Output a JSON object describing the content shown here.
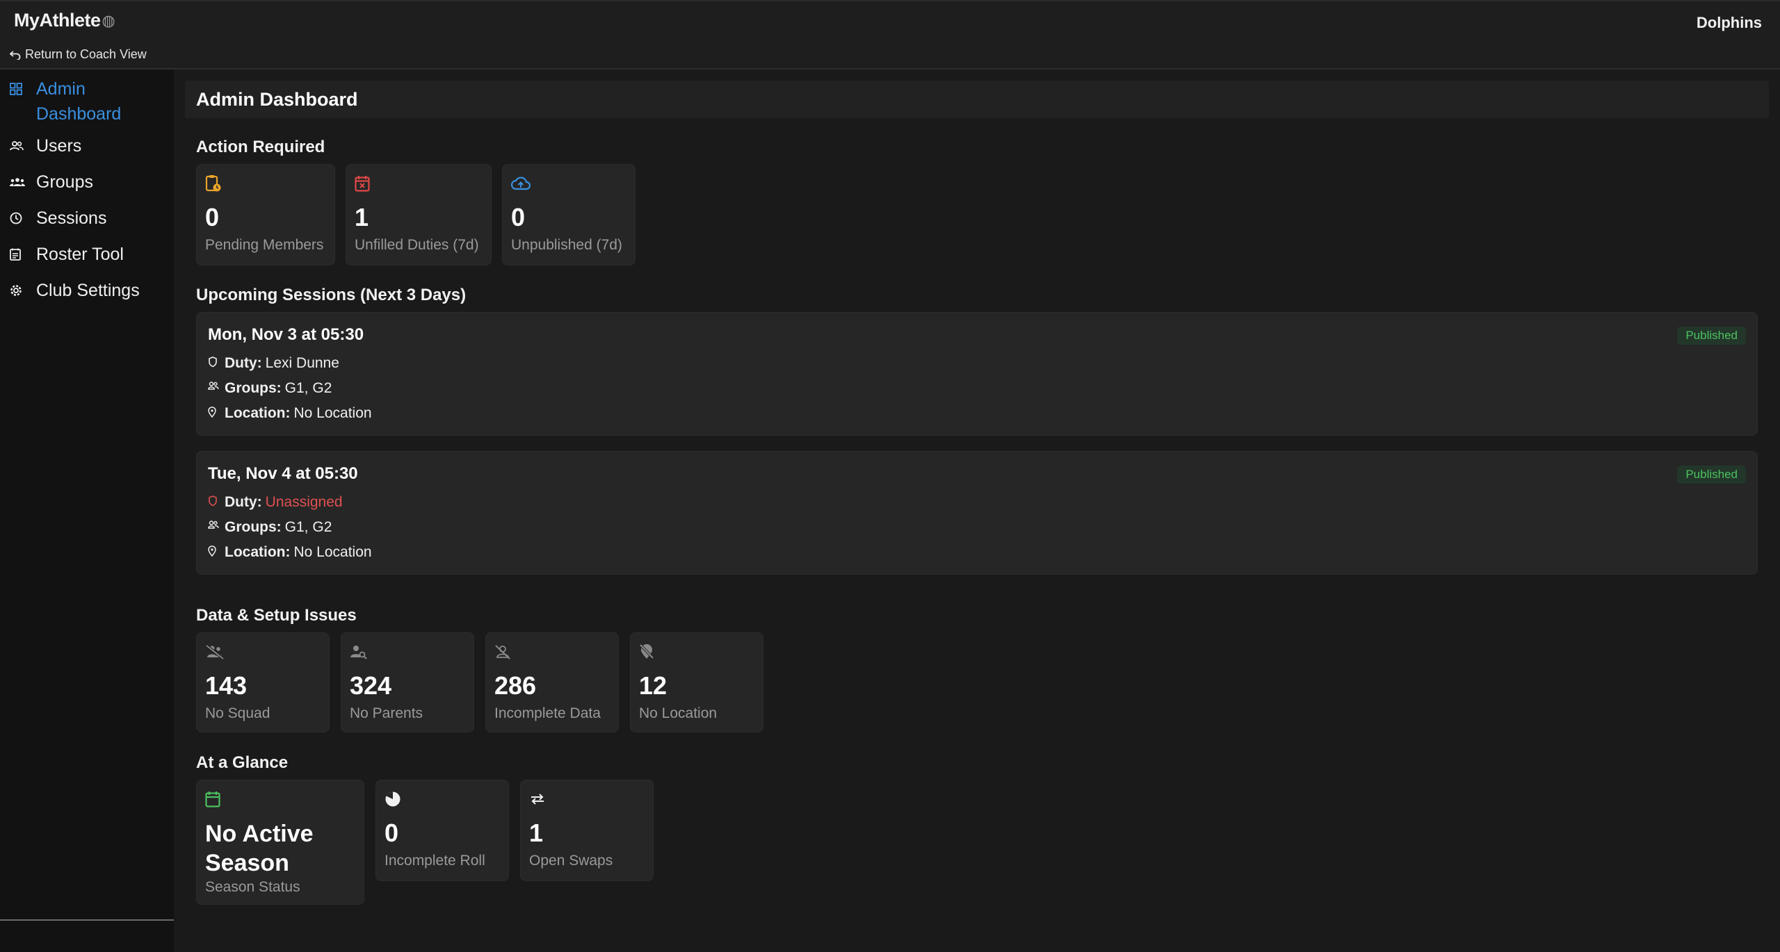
{
  "app": {
    "logo_text": "MyAthlete",
    "return_link": "Return to Coach View",
    "team_name": "Dolphins"
  },
  "sidebar": {
    "items": [
      {
        "label": "Admin Dashboard",
        "icon": "dashboard-icon",
        "active": true
      },
      {
        "label": "Users",
        "icon": "users-icon"
      },
      {
        "label": "Groups",
        "icon": "groups-icon"
      },
      {
        "label": "Sessions",
        "icon": "clock-icon"
      },
      {
        "label": "Roster Tool",
        "icon": "roster-icon"
      },
      {
        "label": "Club Settings",
        "icon": "gear-icon"
      }
    ]
  },
  "main": {
    "page_title": "Admin Dashboard",
    "action_required": {
      "title": "Action Required",
      "cards": [
        {
          "value": "0",
          "label": "Pending Members",
          "icon": "clipboard-clock-icon",
          "color": "#e8a42a"
        },
        {
          "value": "1",
          "label": "Unfilled Duties (7d)",
          "icon": "calendar-x-icon",
          "color": "#e04848"
        },
        {
          "value": "0",
          "label": "Unpublished (7d)",
          "icon": "cloud-upload-icon",
          "color": "#3a8fe0"
        }
      ]
    },
    "upcoming": {
      "title": "Upcoming Sessions (Next 3 Days)",
      "labels": {
        "duty": "Duty:",
        "groups": "Groups:",
        "location": "Location:"
      },
      "sessions": [
        {
          "title": "Mon, Nov 3 at 05:30",
          "duty": "Lexi Dunne",
          "groups": "G1, G2",
          "location": "No Location",
          "status": "Published"
        },
        {
          "title": "Tue, Nov 4 at 05:30",
          "duty": "Unassigned",
          "groups": "G1, G2",
          "location": "No Location",
          "status": "Published"
        }
      ]
    },
    "data_issues": {
      "title": "Data & Setup Issues",
      "cards": [
        {
          "value": "143",
          "label": "No Squad",
          "icon": "group-off-icon"
        },
        {
          "value": "324",
          "label": "No Parents",
          "icon": "person-search-icon"
        },
        {
          "value": "286",
          "label": "Incomplete Data",
          "icon": "person-off-icon"
        },
        {
          "value": "12",
          "label": "No Location",
          "icon": "location-off-icon"
        }
      ]
    },
    "glance": {
      "title": "At a Glance",
      "cards": [
        {
          "value": "No Active Season",
          "label": "Season Status",
          "icon": "calendar-icon",
          "color": "#4cc060"
        },
        {
          "value": "0",
          "label": "Incomplete Roll",
          "icon": "pie-icon"
        },
        {
          "value": "1",
          "label": "Open Swaps",
          "icon": "swap-icon"
        }
      ]
    }
  },
  "colors": {
    "accent": "#3a8fe0",
    "published_text": "#4cc060",
    "danger": "#e05050"
  }
}
